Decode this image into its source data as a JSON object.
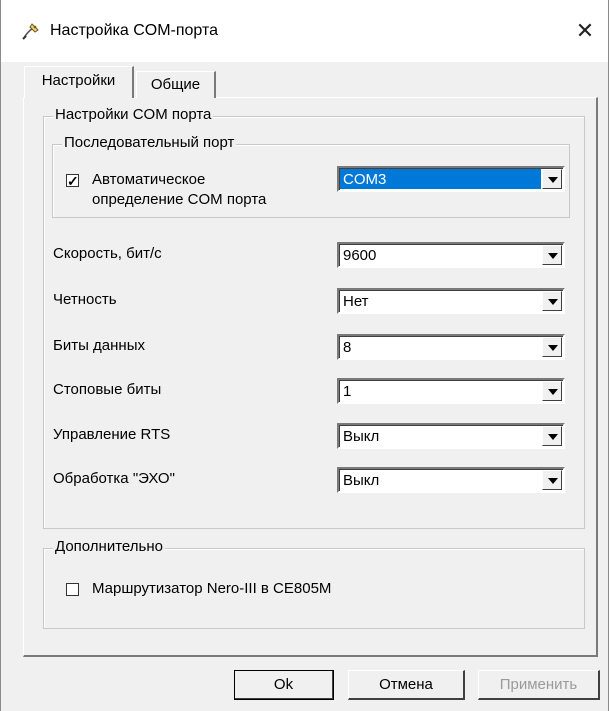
{
  "window": {
    "title": "Настройка COM-порта",
    "icon": "pen-tool-icon",
    "close_glyph": "✕"
  },
  "tabs": [
    {
      "label": "Настройки",
      "active": true
    },
    {
      "label": "Общие",
      "active": false
    }
  ],
  "com_settings": {
    "group_label": "Настройки COM порта",
    "serial_port": {
      "group_label": "Последовательный порт",
      "auto_detect": {
        "label_line1": "Автоматическое",
        "label_line2": "определение COM порта",
        "checked": true,
        "check_glyph": "✓"
      },
      "port_value": "COM3"
    },
    "fields": [
      {
        "label": "Скорость, бит/с",
        "value": "9600"
      },
      {
        "label": "Четность",
        "value": "Нет"
      },
      {
        "label": "Биты данных",
        "value": "8"
      },
      {
        "label": "Стоповые биты",
        "value": "1"
      },
      {
        "label": "Управление RTS",
        "value": "Выкл"
      },
      {
        "label": "Обработка \"ЭХО\"",
        "value": "Выкл"
      }
    ]
  },
  "additional": {
    "group_label": "Дополнительно",
    "router_option": {
      "label": "Маршрутизатор Nero-III в CE805M",
      "checked": false
    }
  },
  "buttons": {
    "ok": "Ok",
    "cancel": "Отмена",
    "apply": "Применить"
  }
}
